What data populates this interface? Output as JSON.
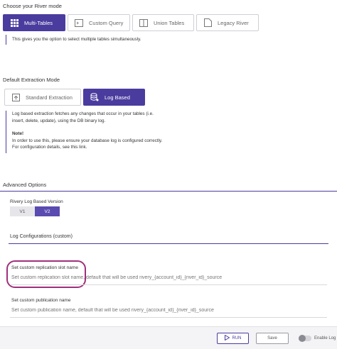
{
  "river_mode": {
    "title": "Choose your River mode",
    "options": [
      {
        "label": "Multi-Tables",
        "icon": "grid-icon",
        "active": true
      },
      {
        "label": "Custom Query",
        "icon": "terminal-icon",
        "active": false
      },
      {
        "label": "Union Tables",
        "icon": "columns-icon",
        "active": false
      },
      {
        "label": "Legacy River",
        "icon": "document-icon",
        "active": false
      }
    ],
    "description": "This gives you the option to select multiple tables simultaneously."
  },
  "extraction": {
    "title": "Default Extraction Mode",
    "options": [
      {
        "label": "Standard Extraction",
        "icon": "upload-box-icon",
        "active": false
      },
      {
        "label": "Log Based",
        "icon": "database-icon",
        "active": true
      }
    ],
    "description_line1": "Log based extraction fetches any changes that occur in your tables (i.e.",
    "description_line2": "insert, delete, update), using the DB binary log.",
    "note_title": "Note!",
    "note_line1": "In order to use this, please ensure your database log is configured correctly.",
    "note_line2": "For configuration details, see this link."
  },
  "advanced": {
    "title": "Advanced Options",
    "version_label": "Rivery Log Based Version",
    "versions": [
      {
        "label": "V1",
        "active": false
      },
      {
        "label": "V2",
        "active": true
      }
    ],
    "log_config_title": "Log Configurations (custom)",
    "slot_label": "Set custom replication slot name",
    "slot_placeholder": "Set custom replication slot name, default that will be used rivery_{account_id}_{river_id}_source",
    "publication_label": "Set custom publication name",
    "publication_placeholder": "Set custom publication name, default that will be used rivery_{account_id}_{river_id}_source"
  },
  "footer": {
    "run_label": "RUN",
    "save_label": "Save",
    "enable_log_label": "Enable Log"
  },
  "colors": {
    "accent": "#4a3c9e",
    "highlight_ring": "#a0307a"
  }
}
